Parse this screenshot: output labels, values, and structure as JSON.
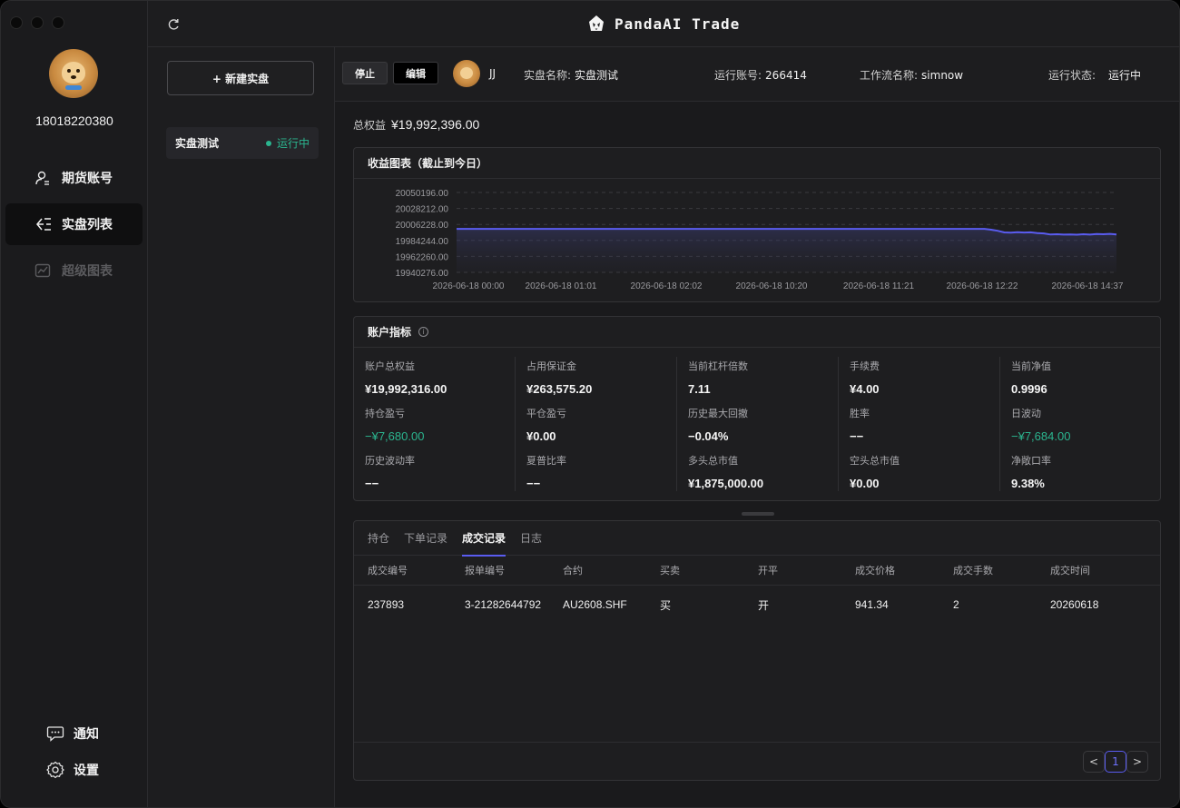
{
  "app": {
    "title": "PandaAI Trade"
  },
  "user": {
    "phone": "18018220380"
  },
  "sidebar": {
    "items": [
      {
        "label": "期货账号",
        "icon": "user-icon"
      },
      {
        "label": "实盘列表",
        "icon": "list-icon"
      },
      {
        "label": "超级图表",
        "icon": "chart-icon"
      }
    ],
    "notify_label": "通知",
    "settings_label": "设置"
  },
  "middle": {
    "new_button": "+ 新建实盘",
    "trades": [
      {
        "name": "实盘测试",
        "status": "运行中"
      }
    ]
  },
  "infobar": {
    "stop_label": "停止",
    "edit_label": "编辑",
    "user_short": "JJ",
    "name_key": "实盘名称:",
    "name_val": "实盘测试",
    "account_key": "运行账号:",
    "account_val": "266414",
    "workflow_key": "工作流名称:",
    "workflow_val": "simnow",
    "status_key": "运行状态:",
    "status_val": "运行中"
  },
  "total_equity": {
    "label": "总权益",
    "value": "¥19,992,396.00"
  },
  "chart_panel": {
    "title": "收益图表（截止到今日）"
  },
  "chart_data": {
    "type": "area",
    "y_ticks": [
      "20050196.00",
      "20028212.00",
      "20006228.00",
      "19984244.00",
      "19962260.00",
      "19940276.00"
    ],
    "ylim": [
      19940276,
      20050196
    ],
    "x_ticks": [
      "2026-06-18 00:00",
      "2026-06-18 01:01",
      "2026-06-18 02:02",
      "2026-06-18 10:20",
      "2026-06-18 11:21",
      "2026-06-18 12:22",
      "2026-06-18 14:37"
    ],
    "grid": true,
    "line_color": "#5a5cf0",
    "values": [
      20000076,
      20000076,
      20000076,
      20000076,
      20000076,
      20000076,
      20000076,
      20000076,
      20000076,
      20000076,
      20000076,
      20000076,
      20000076,
      20000076,
      20000076,
      20000076,
      20000076,
      20000076,
      20000076,
      20000076,
      20000076,
      20000076,
      20000076,
      20000076,
      20000076,
      20000076,
      20000076,
      20000076,
      20000076,
      20000076,
      20000076,
      20000076,
      20000076,
      20000076,
      20000076,
      20000076,
      20000076,
      20000076,
      20000076,
      20000076,
      20000076,
      20000076,
      20000076,
      20000076,
      20000076,
      20000076,
      20000076,
      20000076,
      20000076,
      20000076,
      20000076,
      20000076,
      20000076,
      20000076,
      20000076,
      20000076,
      20000076,
      20000076,
      20000076,
      20000076,
      20000076,
      20000076,
      20000076,
      20000076,
      20000076,
      20000076,
      20000076,
      20000076,
      20000076,
      20000076,
      20000076,
      20000076,
      20000076,
      20000076,
      20000076,
      20000076,
      20000076,
      20000076,
      20000076,
      20000076,
      20000076,
      19999000,
      19997500,
      19995200,
      19994800,
      19995600,
      19995100,
      19995400,
      19994200,
      19993900,
      19992400,
      19992700,
      19992300,
      19992500,
      19992100,
      19992700,
      19992300,
      19993100,
      19992800,
      19993200,
      19992396
    ]
  },
  "metrics": {
    "title": "账户指标",
    "info_glyph": "i",
    "items": [
      {
        "k": "账户总权益",
        "v": "¥19,992,316.00"
      },
      {
        "k": "占用保证金",
        "v": "¥263,575.20"
      },
      {
        "k": "当前杠杆倍数",
        "v": "7.11"
      },
      {
        "k": "手续费",
        "v": "¥4.00"
      },
      {
        "k": "当前净值",
        "v": "0.9996"
      },
      {
        "k": "持仓盈亏",
        "v": "−¥7,680.00"
      },
      {
        "k": "平仓盈亏",
        "v": "¥0.00"
      },
      {
        "k": "历史最大回撤",
        "v": "−0.04%"
      },
      {
        "k": "胜率",
        "v": "−−"
      },
      {
        "k": "日波动",
        "v": "−¥7,684.00"
      },
      {
        "k": "历史波动率",
        "v": "−−"
      },
      {
        "k": "夏普比率",
        "v": "−−"
      },
      {
        "k": "多头总市值",
        "v": "¥1,875,000.00"
      },
      {
        "k": "空头总市值",
        "v": "¥0.00"
      },
      {
        "k": "净敞口率",
        "v": "9.38%"
      }
    ]
  },
  "tabs": [
    "持仓",
    "下单记录",
    "成交记录",
    "日志"
  ],
  "table": {
    "headers": [
      "成交编号",
      "报单编号",
      "合约",
      "买卖",
      "开平",
      "成交价格",
      "成交手数",
      "成交时间"
    ],
    "rows": [
      [
        "237893",
        "3-21282644792",
        "AU2608.SHF",
        "买",
        "开",
        "941.34",
        "2",
        "20260618"
      ]
    ]
  },
  "pager": {
    "prev": "<",
    "current": "1",
    "next": ">"
  }
}
